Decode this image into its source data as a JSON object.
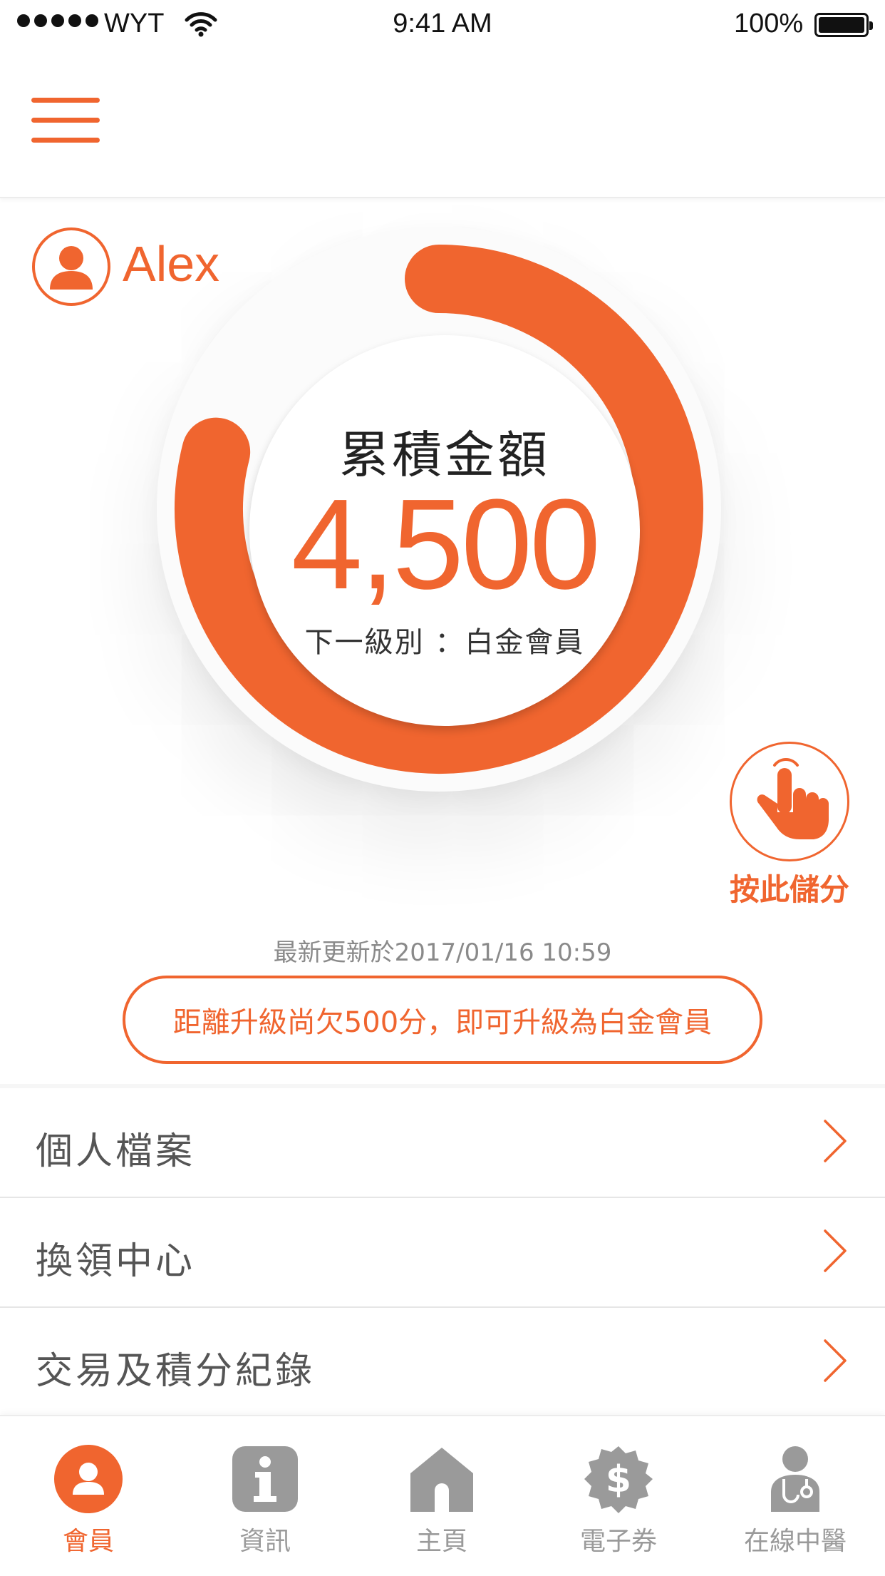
{
  "status_bar": {
    "carrier": "WYT",
    "time": "9:41 AM",
    "battery": "100%"
  },
  "user": {
    "name": "Alex"
  },
  "points_ring": {
    "title": "累積金額",
    "value": "4,500",
    "next_level": "下一級別 ：白金會員",
    "progress": 0.79
  },
  "earn_button": {
    "label": "按此儲分"
  },
  "updated": "最新更新於2017/01/16 10:59",
  "upgrade_notice": "距離升級尚欠500分，即可升級為白金會員",
  "menu": [
    {
      "label": "個人檔案"
    },
    {
      "label": "換領中心"
    },
    {
      "label": "交易及積分紀錄"
    }
  ],
  "tabs": [
    {
      "label": "會員",
      "icon": "member-icon",
      "active": true
    },
    {
      "label": "資訊",
      "icon": "info-icon",
      "active": false
    },
    {
      "label": "主頁",
      "icon": "home-icon",
      "active": false
    },
    {
      "label": "電子券",
      "icon": "coupon-icon",
      "active": false
    },
    {
      "label": "在線中醫",
      "icon": "doctor-icon",
      "active": false
    }
  ],
  "colors": {
    "accent": "#f0652f",
    "inactive": "#9a9a9a"
  }
}
